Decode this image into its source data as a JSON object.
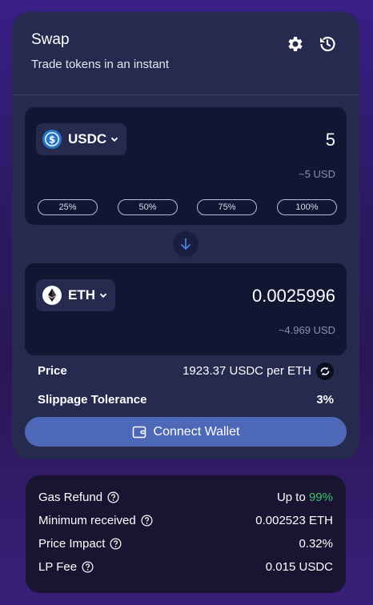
{
  "header": {
    "title": "Swap",
    "subtitle": "Trade tokens in an instant",
    "settings_icon": "gear-icon",
    "history_icon": "history-icon"
  },
  "from": {
    "token": "USDC",
    "amount": "5",
    "usd_value": "~5 USD",
    "percent_buttons": [
      "25%",
      "50%",
      "75%",
      "100%"
    ]
  },
  "to": {
    "token": "ETH",
    "amount": "0.0025996",
    "usd_value": "~4.969 USD"
  },
  "price": {
    "label": "Price",
    "value": "1923.37 USDC per ETH"
  },
  "slippage": {
    "label": "Slippage Tolerance",
    "value": "3%"
  },
  "connect_label": "Connect Wallet",
  "details": {
    "gas_refund": {
      "label": "Gas Refund",
      "prefix": "Up to",
      "value": "99%"
    },
    "min_received": {
      "label": "Minimum received",
      "value": "0.002523 ETH"
    },
    "price_impact": {
      "label": "Price Impact",
      "value": "0.32%"
    },
    "lp_fee": {
      "label": "LP Fee",
      "value": "0.015 USDC"
    }
  },
  "colors": {
    "accent": "#4e68b8",
    "positive": "#3ec46d",
    "card": "#262a4f",
    "panel": "#111633"
  }
}
